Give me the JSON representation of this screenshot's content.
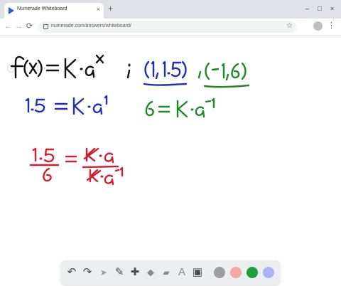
{
  "browser": {
    "tab_title": "Numerade Whiteboard",
    "tab_close": "×",
    "new_tab": "+",
    "url": "numerade.com/answers/whiteboard/",
    "back": "←",
    "forward": "→",
    "reload": "⟳",
    "star": "☆",
    "menu": "⋮",
    "minimize": "–",
    "maximize": "□",
    "close": "×"
  },
  "whiteboard": {
    "scroll_hint": "↓",
    "lines": [
      {
        "text": "f(x) = K · a^x",
        "color": "#111111"
      },
      {
        "text": "; (1, 1.5)",
        "color": "#1f2fb8"
      },
      {
        "text": ", (−1, 6)",
        "color": "#1d8a2a"
      },
      {
        "text": "1.5 = K · a^1",
        "color": "#1f2fb8"
      },
      {
        "text": "6 = K · a^−1",
        "color": "#1d8a2a"
      },
      {
        "text": "1.5 / 6 = K·a / K·a^−1",
        "color": "#d01f2f"
      }
    ]
  },
  "toolbar": {
    "undo": "↶",
    "redo": "↷",
    "select": "➤",
    "pen": "✎",
    "add": "✚",
    "shapes": "◆",
    "eraser": "▰",
    "text": "A",
    "image": "▣",
    "colors": [
      "#9e9e9e",
      "#f4a6a6",
      "#1e9e3a",
      "#a9b3f5"
    ]
  }
}
